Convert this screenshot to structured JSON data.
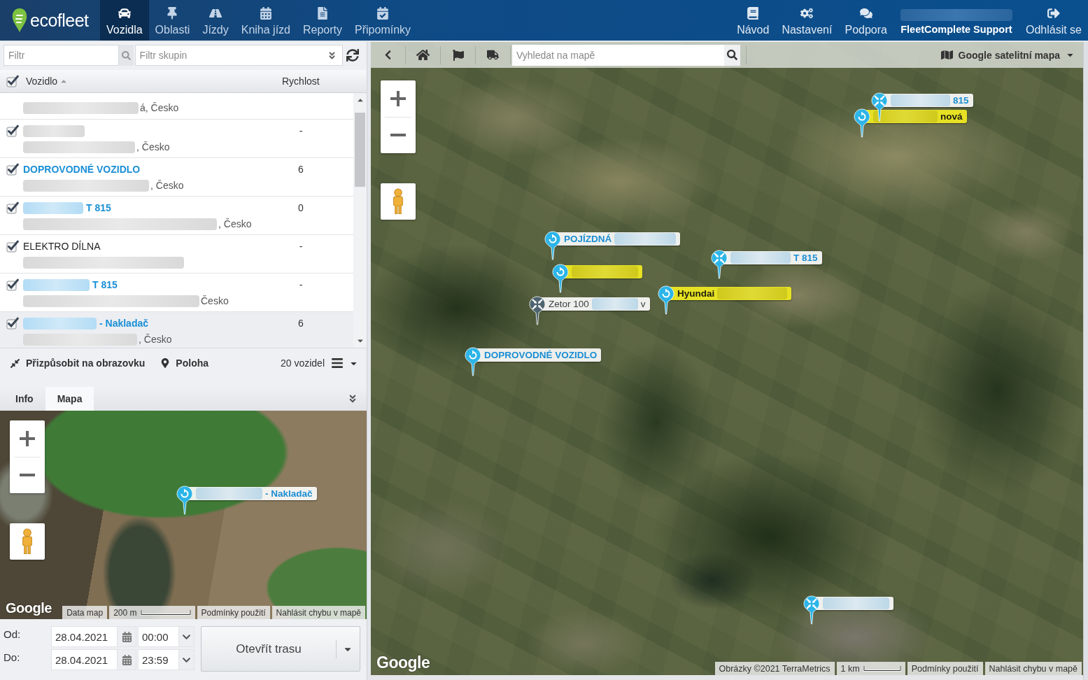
{
  "top_nav": {
    "logo": "ecofleet",
    "tabs": [
      {
        "label": "Vozidla",
        "selected": true
      },
      {
        "label": "Oblasti",
        "selected": false
      },
      {
        "label": "Jízdy",
        "selected": false
      },
      {
        "label": "Kniha jízd",
        "selected": false
      },
      {
        "label": "Reporty",
        "selected": false
      },
      {
        "label": "Připomínky",
        "selected": false
      }
    ],
    "links": [
      {
        "label": "Návod"
      },
      {
        "label": "Nastavení"
      },
      {
        "label": "Podpora"
      }
    ],
    "account": {
      "label": "FleetComplete Support"
    },
    "logout": {
      "label": "Odhlásit se"
    }
  },
  "vehicle_list": {
    "filter": {
      "placeholder": "Filtr"
    },
    "group_filter": {
      "placeholder": "Filtr skupin"
    },
    "select_all_checked": true,
    "columns": [
      {
        "label": "Vozidlo",
        "sorted": true
      },
      {
        "label": "Rychlost"
      }
    ],
    "rows": [
      {
        "kind": "partial",
        "selected": false,
        "address_parts": [
          {
            "kind": "redacted"
          },
          {
            "kind": "text",
            "text": "á, Česko"
          }
        ]
      },
      {
        "kind": "plain",
        "checked": true,
        "selected": false,
        "name_parts": [
          {
            "kind": "redacted"
          }
        ],
        "address_parts": [
          {
            "kind": "redacted"
          },
          {
            "kind": "text",
            "text": ", Česko"
          }
        ],
        "speed": "-"
      },
      {
        "kind": "link",
        "checked": true,
        "selected": false,
        "name_parts": [
          {
            "kind": "text",
            "text": "DOPROVODNÉ VOZIDLO"
          }
        ],
        "address_parts": [
          {
            "kind": "redacted"
          },
          {
            "kind": "text",
            "text": ", Česko"
          }
        ],
        "speed": "6"
      },
      {
        "kind": "link",
        "checked": true,
        "selected": false,
        "name_parts": [
          {
            "kind": "redacted"
          },
          {
            "kind": "text",
            "text": "T 815"
          }
        ],
        "address_parts": [
          {
            "kind": "redacted"
          },
          {
            "kind": "text",
            "text": ", Česko"
          }
        ],
        "speed": "0"
      },
      {
        "kind": "plain",
        "checked": true,
        "selected": false,
        "name_parts": [
          {
            "kind": "text",
            "text": "ELEKTRO DÍLNA"
          }
        ],
        "address_parts": [
          {
            "kind": "redacted"
          }
        ],
        "speed": "-"
      },
      {
        "kind": "link",
        "checked": true,
        "selected": false,
        "name_parts": [
          {
            "kind": "redacted"
          },
          {
            "kind": "text",
            "text": "T 815"
          }
        ],
        "address_parts": [
          {
            "kind": "redacted"
          },
          {
            "kind": "text",
            "text": "Česko"
          }
        ],
        "speed": "-"
      },
      {
        "kind": "link",
        "checked": true,
        "selected": true,
        "name_parts": [
          {
            "kind": "redacted"
          },
          {
            "kind": "text",
            "text": "- Nakladač"
          }
        ],
        "address_parts": [
          {
            "kind": "redacted"
          },
          {
            "kind": "text",
            "text": ", Česko"
          }
        ],
        "speed": "6"
      }
    ],
    "toolbar": {
      "fit_label": "Přizpůsobit na obrazovku",
      "location_label": "Poloha",
      "count": "20 vozidel"
    }
  },
  "detail_tabs": [
    {
      "label": "Info",
      "selected": false
    },
    {
      "label": "Mapa",
      "selected": true
    }
  ],
  "mini_map": {
    "markers": [
      {
        "kind": "rotate",
        "offline": false,
        "highlighted": false,
        "label_parts": [
          {
            "kind": "redacted"
          },
          {
            "kind": "text",
            "text": "- Nakladač"
          }
        ]
      }
    ],
    "logo": "Google",
    "footer": [
      {
        "kind": "text",
        "text": "Data map"
      },
      {
        "kind": "scale",
        "text": "200 m"
      },
      {
        "kind": "link",
        "text": "Podmínky použití"
      },
      {
        "kind": "link",
        "text": "Nahlásit chybu v mapě"
      }
    ]
  },
  "route_form": {
    "rows": [
      {
        "label": "Od:",
        "date": "28.04.2021",
        "time": "00:00"
      },
      {
        "label": "Do:",
        "date": "28.04.2021",
        "time": "23:59"
      }
    ],
    "button": "Otevřít trasu"
  },
  "main_map": {
    "search": {
      "placeholder": "Vyhledat na mapě"
    },
    "map_type": "Google satelitní mapa",
    "markers": [
      {
        "kind": "arrows",
        "offline": false,
        "highlighted": false,
        "label_parts": [
          {
            "kind": "redacted"
          },
          {
            "kind": "text",
            "text": "815"
          }
        ]
      },
      {
        "kind": "rotate",
        "offline": false,
        "highlighted": true,
        "label_parts": [
          {
            "kind": "redacted"
          },
          {
            "kind": "text",
            "text": "nová"
          }
        ]
      },
      {
        "kind": "rotate",
        "offline": false,
        "highlighted": false,
        "label_parts": [
          {
            "kind": "text",
            "text": "POJÍZDNÁ"
          },
          {
            "kind": "redacted"
          }
        ]
      },
      {
        "kind": "rotate",
        "offline": false,
        "highlighted": true,
        "label_parts": [
          {
            "kind": "redacted"
          }
        ]
      },
      {
        "kind": "arrows",
        "offline": false,
        "highlighted": false,
        "label_parts": [
          {
            "kind": "redacted"
          },
          {
            "kind": "text",
            "text": "T 815"
          }
        ]
      },
      {
        "kind": "rotate",
        "offline": false,
        "highlighted": true,
        "label_parts": [
          {
            "kind": "text",
            "text": "Hyundai"
          },
          {
            "kind": "redacted"
          }
        ]
      },
      {
        "kind": "arrows",
        "offline": true,
        "highlighted": false,
        "label_parts": [
          {
            "kind": "text",
            "text": "Zetor 100"
          },
          {
            "kind": "redacted"
          },
          {
            "kind": "text",
            "text": "v"
          }
        ]
      },
      {
        "kind": "rotate",
        "offline": false,
        "highlighted": false,
        "label_parts": [
          {
            "kind": "text",
            "text": "DOPROVODNÉ VOZIDLO"
          }
        ]
      },
      {
        "kind": "arrows",
        "offline": false,
        "highlighted": false,
        "label_parts": [
          {
            "kind": "redacted"
          }
        ]
      }
    ],
    "logo": "Google",
    "footer": [
      {
        "kind": "text",
        "text": "Obrázky ©2021 TerraMetrics"
      },
      {
        "kind": "scale",
        "text": "1 km"
      },
      {
        "kind": "link",
        "text": "Podmínky použití"
      },
      {
        "kind": "link",
        "text": "Nahlásit chybu v mapě"
      }
    ]
  }
}
